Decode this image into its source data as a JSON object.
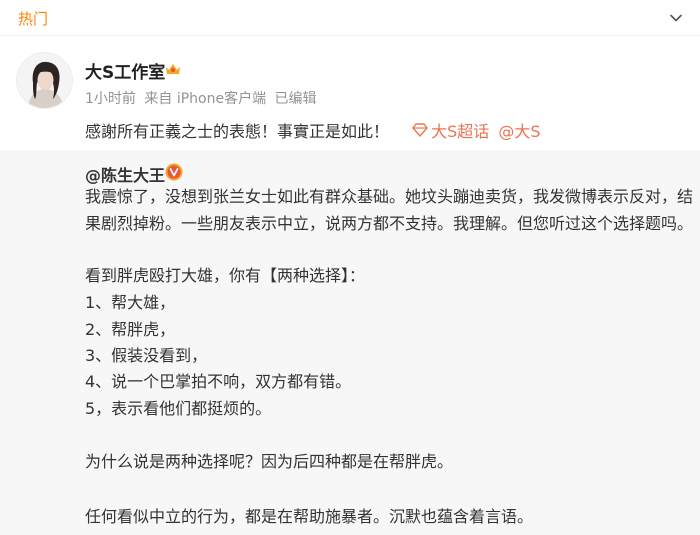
{
  "header": {
    "tab_label": "热门",
    "collapse_icon": "chevron-down-icon"
  },
  "post": {
    "author": "大S工作室",
    "badge_icon": "vip-crown-icon",
    "meta": {
      "time": "1小时前",
      "source": "来自 iPhone客户端",
      "edited": "已编辑"
    },
    "text": "感謝所有正義之士的表態！事實正是如此！",
    "topic_icon": "super-topic-icon",
    "topic": "大S超话",
    "mention": "@大S"
  },
  "quoted": {
    "author": "@陈生大王",
    "badge_icon": "verified-v-icon",
    "lines": [
      "我震惊了，没想到张兰女士如此有群众基础。她坟头蹦迪卖货，我发微博表示反对，结",
      "果剧烈掉粉。一些朋友表示中立，说两方都不支持。我理解。但您听过这个选择题吗。",
      "看到胖虎殴打大雄，你有【两种选择】：",
      "1、帮大雄，",
      "2、帮胖虎，",
      "3、假装没看到，",
      "4、说一个巴掌拍不响，双方都有错。",
      "5，表示看他们都挺烦的。",
      "为什么说是两种选择呢？因为后四种都是在帮胖虎。",
      "任何看似中立的行为，都是在帮助施暴者。沉默也蕴含着言语。"
    ]
  },
  "colors": {
    "accent": "#ff8200",
    "link": "#eb7350",
    "quote_bg": "#f7f7f7",
    "meta": "#939393"
  }
}
